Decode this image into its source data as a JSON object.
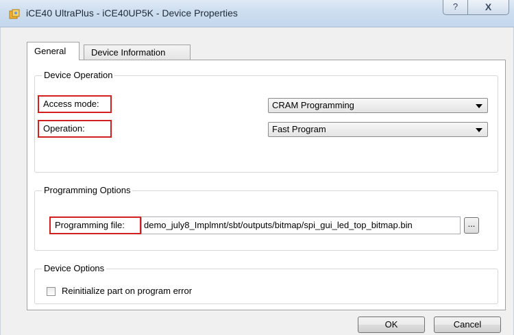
{
  "window": {
    "title": "iCE40 UltraPlus - iCE40UP5K - Device Properties",
    "help_label": "?",
    "close_label": "X"
  },
  "tabs": [
    {
      "label": "General",
      "active": true
    },
    {
      "label": "Device Information",
      "active": false
    }
  ],
  "device_operation": {
    "title": "Device Operation",
    "access_mode_label": "Access mode:",
    "access_mode_value": "CRAM Programming",
    "operation_label": "Operation:",
    "operation_value": "Fast Program"
  },
  "programming_options": {
    "title": "Programming Options",
    "file_label": "Programming file:",
    "file_value": "demo_july8_Implmnt/sbt/outputs/bitmap/spi_gui_led_top_bitmap.bin",
    "browse_label": "..."
  },
  "device_options": {
    "title": "Device Options",
    "reinit_label": "Reinitialize part on program error",
    "reinit_checked": false
  },
  "buttons": {
    "ok": "OK",
    "cancel": "Cancel"
  },
  "colors": {
    "highlight_border": "#d11f1f",
    "titlebar": "#cfdff0"
  }
}
